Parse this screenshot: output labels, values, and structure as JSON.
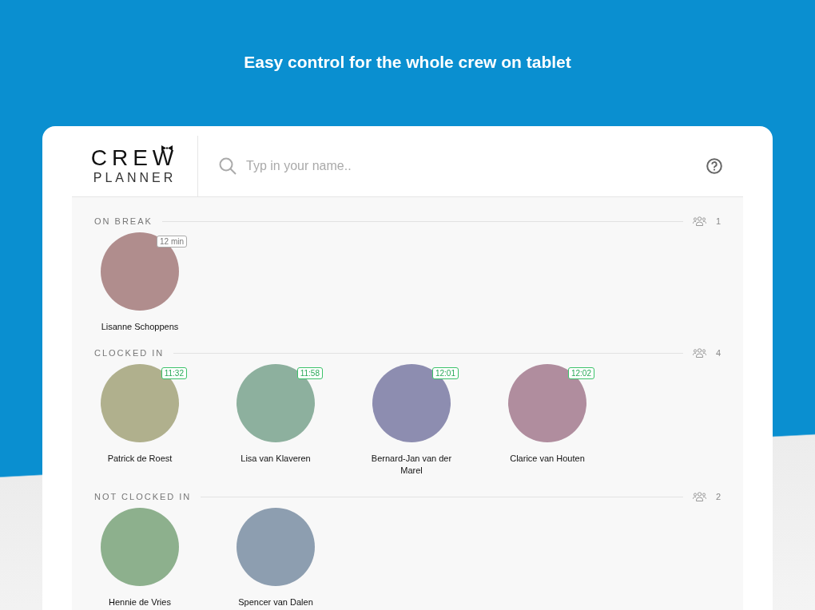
{
  "headline": "Easy control for the whole crew on tablet",
  "logo": {
    "top": "CREW",
    "bottom": "PLANNER"
  },
  "search": {
    "placeholder": "Typ in your name.."
  },
  "sections": [
    {
      "title": "ON BREAK",
      "count": "1",
      "kind": "break",
      "people": [
        {
          "name": "Lisanne Schoppens",
          "badge": "12 min"
        }
      ]
    },
    {
      "title": "CLOCKED IN",
      "count": "4",
      "kind": "clocked",
      "people": [
        {
          "name": "Patrick de Roest",
          "badge": "11:32"
        },
        {
          "name": "Lisa van Klaveren",
          "badge": "11:58"
        },
        {
          "name": "Bernard-Jan van der Marel",
          "badge": "12:01"
        },
        {
          "name": "Clarice van Houten",
          "badge": "12:02"
        }
      ]
    },
    {
      "title": "NOT CLOCKED IN",
      "count": "2",
      "people": [
        {
          "name": "Hennie de Vries"
        },
        {
          "name": "Spencer van Dalen"
        }
      ]
    }
  ]
}
